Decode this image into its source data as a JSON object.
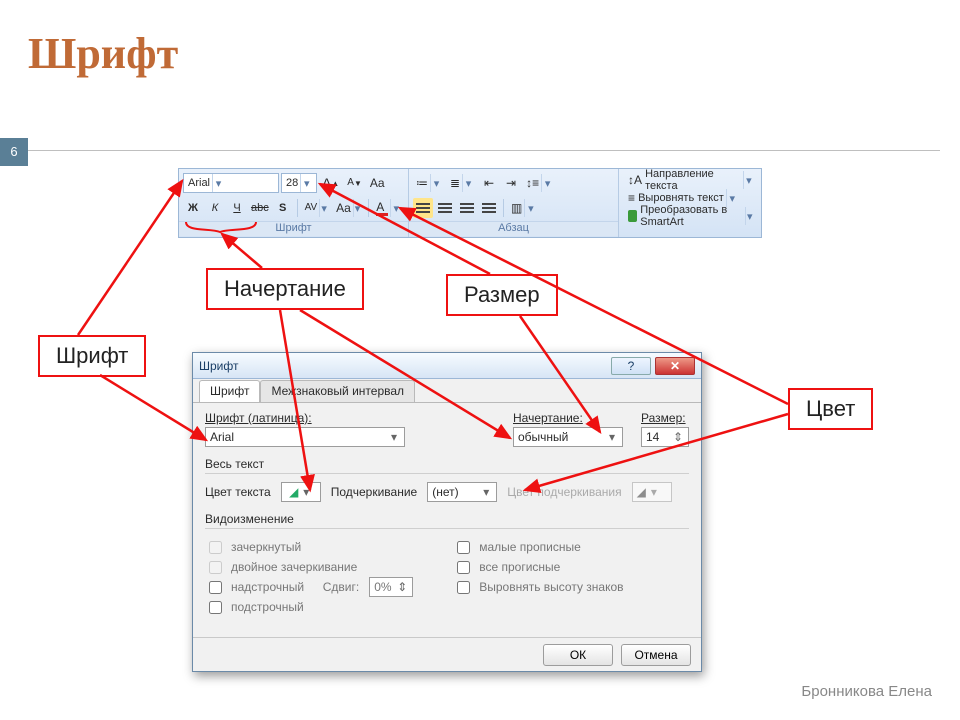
{
  "slide": {
    "title": "Шрифт",
    "page": "6",
    "author": "Бронникова Елена"
  },
  "callouts": {
    "font": "Шрифт",
    "style": "Начертание",
    "size": "Размер",
    "color": "Цвет"
  },
  "ribbon": {
    "font_group_caption": "Шрифт",
    "para_group_caption": "Абзац",
    "font_name": "Arial",
    "font_size": "28",
    "bold": "Ж",
    "italic": "К",
    "underline": "Ч",
    "strike": "abc",
    "shadow": "S",
    "spacing": "AV",
    "case": "Aa",
    "color": "A",
    "grow": "A",
    "shrink": "A",
    "clear": "Aa",
    "dir_label": "Направление текста",
    "align_label": "Выровнять текст",
    "smartart_label": "Преобразовать в SmartArt"
  },
  "dialog": {
    "title": "Шрифт",
    "tabs": [
      "Шрифт",
      "Межзнаковый интервал"
    ],
    "font_label": "Шрифт (латиница):",
    "font_value": "Arial",
    "style_label": "Начертание:",
    "style_value": "обычный",
    "size_label": "Размер:",
    "size_value": "14",
    "alltext": "Весь текст",
    "textcolor": "Цвет текста",
    "underline_label": "Подчеркивание",
    "underline_value": "(нет)",
    "ulcolor_label": "Цвет подчеркивания",
    "mods": "Видоизменение",
    "chk": {
      "strike": "зачеркнутый",
      "dbl": "двойное зачеркивание",
      "sup": "надстрочный",
      "sub": "подстрочный",
      "small": "малые прописные",
      "allcaps": "все прогисные",
      "eq": "Выровнять высоту знаков"
    },
    "offset_label": "Сдвиг:",
    "offset_value": "0%",
    "ok": "ОК",
    "cancel": "Отмена"
  }
}
